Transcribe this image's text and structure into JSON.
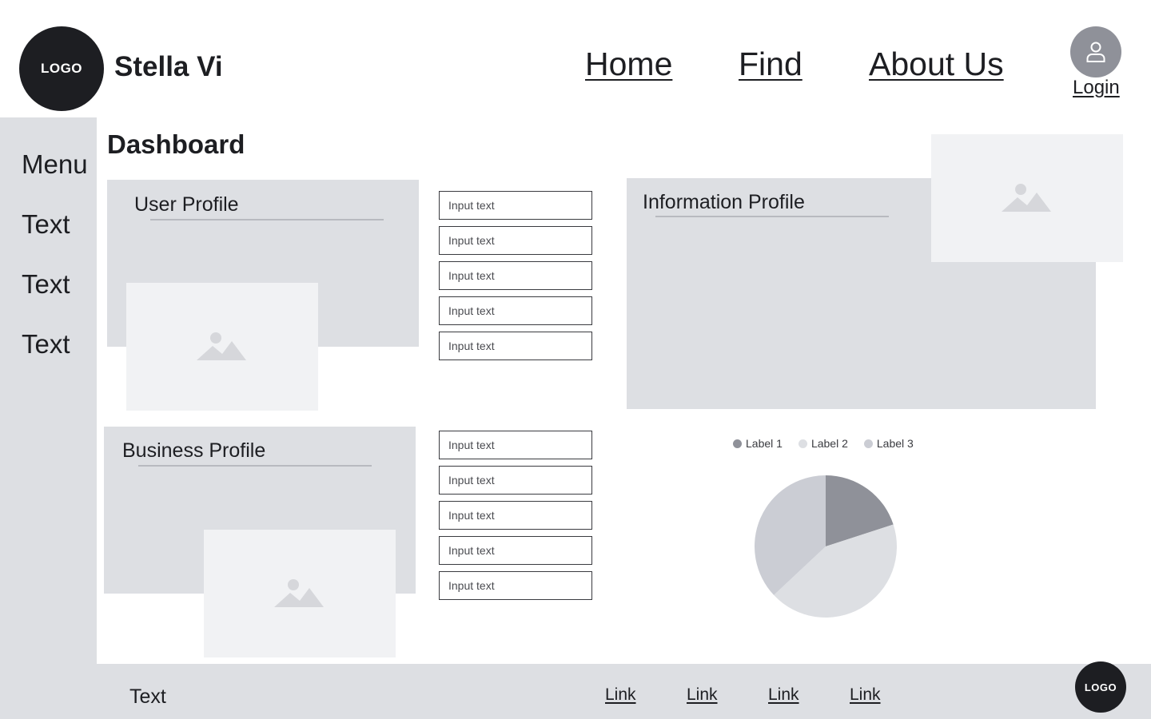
{
  "header": {
    "logo_text": "LOGO",
    "brand_name": "Stella Vi",
    "nav": {
      "home": "Home",
      "find": "Find",
      "about": "About Us"
    },
    "login": "Login",
    "avatar_icon": "user-icon"
  },
  "sidebar": {
    "menu": "Menu",
    "items": [
      "Text",
      "Text",
      "Text"
    ]
  },
  "main": {
    "title": "Dashboard",
    "user_profile": {
      "title": "User Profile",
      "image_icon": "image-placeholder-icon"
    },
    "business_profile": {
      "title": "Business Profile",
      "image_icon": "image-placeholder-icon"
    },
    "information_profile": {
      "title": "Information Profile",
      "image_icon": "image-placeholder-icon"
    },
    "inputs_top": [
      "Input text",
      "Input text",
      "Input text",
      "Input text",
      "Input text"
    ],
    "inputs_bottom": [
      "Input text",
      "Input text",
      "Input text",
      "Input text",
      "Input text"
    ]
  },
  "chart_data": {
    "type": "pie",
    "categories": [
      "Label 1",
      "Label 2",
      "Label 3"
    ],
    "values": [
      20,
      43,
      37
    ],
    "colors": [
      "#8f9199",
      "#dddfe3",
      "#cbcdd4"
    ],
    "legend_position": "top"
  },
  "footer": {
    "text": "Text",
    "links": [
      "Link",
      "Link",
      "Link",
      "Link"
    ],
    "logo_text": "LOGO"
  },
  "colors": {
    "panel": "#dddfe3",
    "placeholder": "#f1f2f4",
    "dark": "#1d1e22"
  }
}
